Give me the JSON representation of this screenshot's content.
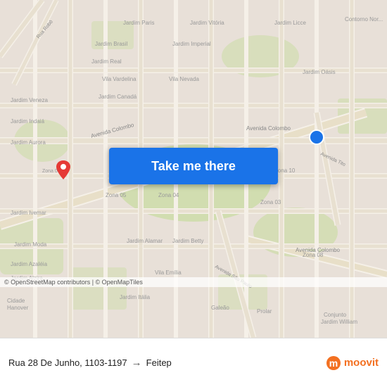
{
  "map": {
    "attribution": "© OpenStreetMap contributors | © OpenMapTiles",
    "button_label": "Take me there",
    "accent_color": "#1a73e8",
    "destination_marker_color": "#1a73e8",
    "origin_marker_color": "#e53935"
  },
  "route": {
    "origin": "Rua 28 De Junho, 1103-1197",
    "destination": "Feitep",
    "arrow": "→"
  },
  "branding": {
    "name": "moovit",
    "logo_color": "#f37021"
  }
}
